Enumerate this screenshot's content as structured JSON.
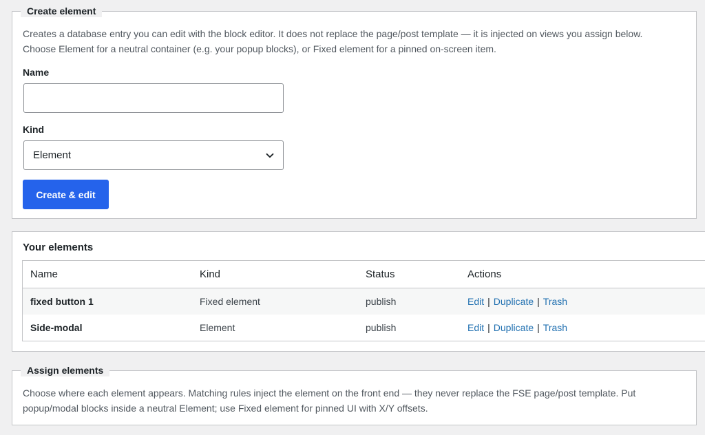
{
  "create": {
    "legend": "Create element",
    "description_line1": "Creates a database entry you can edit with the block editor. It does not replace the page/post template — it is injected on views you assign below.",
    "description_line2": "Choose Element for a neutral container (e.g. your popup blocks), or Fixed element for a pinned on-screen item.",
    "name_label": "Name",
    "name_value": "",
    "name_placeholder": "",
    "kind_label": "Kind",
    "kind_selected": "Element",
    "submit_label": "Create & edit"
  },
  "elements": {
    "title": "Your elements",
    "columns": [
      "Name",
      "Kind",
      "Status",
      "Actions"
    ],
    "rows": [
      {
        "name": "fixed button 1",
        "kind": "Fixed element",
        "status": "publish",
        "edit": "Edit",
        "duplicate": "Duplicate",
        "trash": "Trash"
      },
      {
        "name": "Side-modal",
        "kind": "Element",
        "status": "publish",
        "edit": "Edit",
        "duplicate": "Duplicate",
        "trash": "Trash"
      }
    ],
    "separator": "|"
  },
  "assign": {
    "legend": "Assign elements",
    "description_line1": "Choose where each element appears. Matching rules inject the element on the front end — they never replace the FSE page/post template. Put",
    "description_line2": "popup/modal blocks inside a neutral Element; use Fixed element for pinned UI with X/Y offsets."
  },
  "icons": {
    "select_chevron": "chevron-down-icon"
  },
  "colors": {
    "primary": "#2563eb",
    "link": "#2271b1",
    "background": "#f0f0f1"
  }
}
